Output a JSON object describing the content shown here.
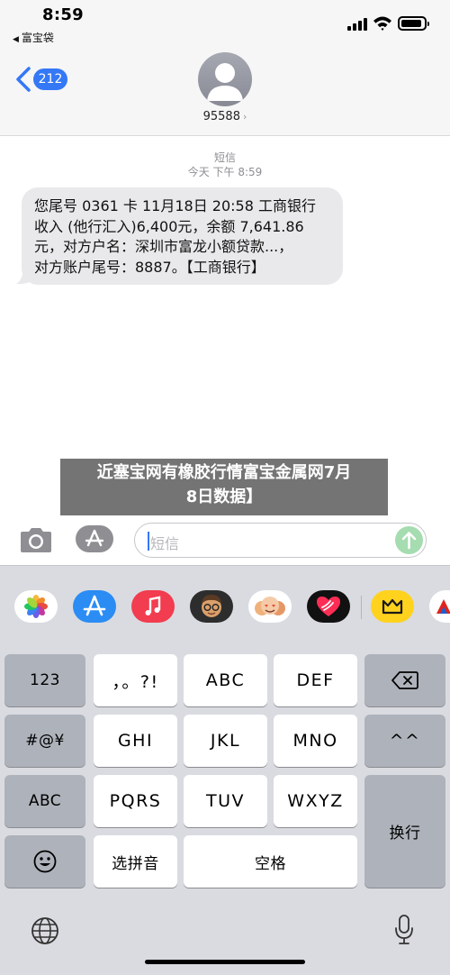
{
  "status_bar": {
    "time": "8:59",
    "back_app": "富宝袋"
  },
  "header": {
    "unread_count": "212",
    "contact": "95588"
  },
  "conversation": {
    "service_label": "短信",
    "timestamp": "今天 下午 8:59",
    "message": "您尾号 0361 卡 11月18日 20:58 工商银行\n收入 (他行汇入)6,400元，余额 7,641.86\n元，对方户名：深圳市富龙小额贷款...，\n对方账户尾号：8887。【工商银行】"
  },
  "overlay": {
    "caption": "近塞宝网有橡胶行情富宝金属网7月\n8日数据】"
  },
  "input": {
    "placeholder": "短信"
  },
  "app_drawer": {
    "apps": [
      "photos",
      "app-store",
      "music",
      "memoji",
      "memoji-stickers",
      "digital-touch",
      "extra-app",
      "more-app"
    ]
  },
  "keyboard": {
    "rows": [
      [
        "123",
        "，。?!",
        "ABC",
        "DEF",
        "delete"
      ],
      [
        "#@¥",
        "GHI",
        "JKL",
        "MNO",
        "^^"
      ],
      [
        "ABC",
        "PQRS",
        "TUV",
        "WXYZ",
        "换行"
      ],
      [
        "emoji",
        "选拼音",
        "空格"
      ]
    ],
    "key_123": "123",
    "key_punct": "，。?!",
    "key_abc": "ABC",
    "key_def": "DEF",
    "key_symbols": "#@¥",
    "key_ghi": "GHI",
    "key_jkl": "JKL",
    "key_mno": "MNO",
    "key_caret": "^^",
    "key_abc_mode": "ABC",
    "key_pqrs": "PQRS",
    "key_tuv": "TUV",
    "key_wxyz": "WXYZ",
    "key_return": "换行",
    "key_pinyin": "选拼音",
    "key_space": "空格"
  },
  "colors": {
    "accent": "#3478f6",
    "bubble": "#e9e9eb",
    "keyboard_bg": "#d9dbe0",
    "send_disabled": "#a5dcb0"
  }
}
